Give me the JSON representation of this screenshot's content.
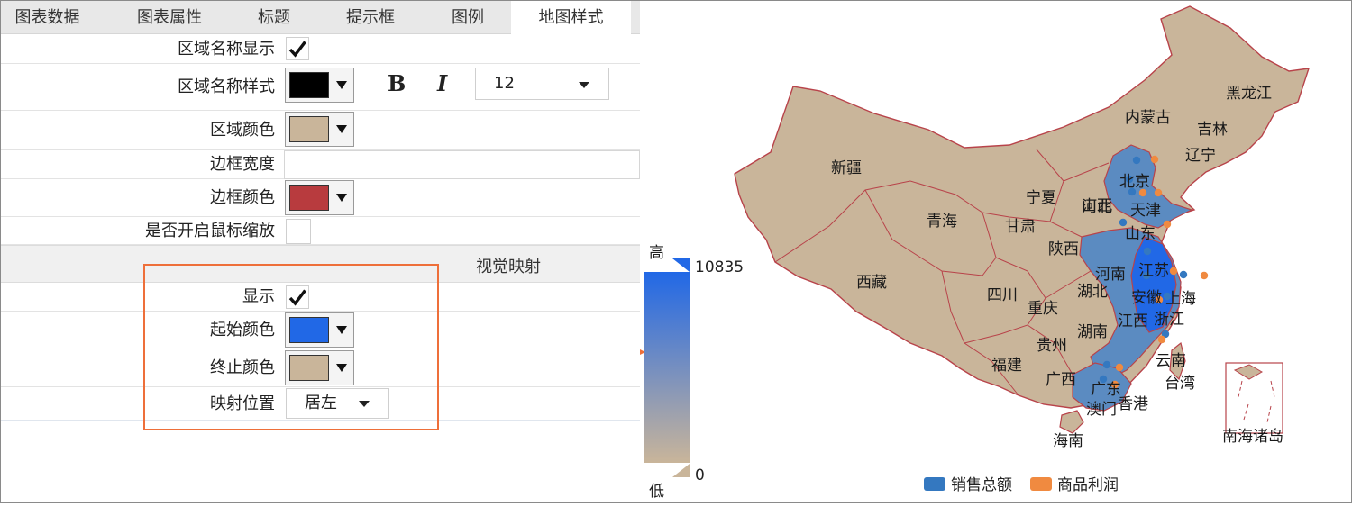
{
  "tabs": [
    {
      "label": "图表数据"
    },
    {
      "label": "图表属性"
    },
    {
      "label": "标题"
    },
    {
      "label": "提示框"
    },
    {
      "label": "图例"
    },
    {
      "label": "地图样式"
    }
  ],
  "settings": {
    "region_name_show": {
      "label": "区域名称显示",
      "checked": true
    },
    "region_name_style": {
      "label": "区域名称样式",
      "color": "#000000",
      "bold_label": "B",
      "italic_label": "I",
      "font_size": "12"
    },
    "region_color": {
      "label": "区域颜色",
      "color": "#c9b59a"
    },
    "border_width": {
      "label": "边框宽度",
      "value": ""
    },
    "border_color": {
      "label": "边框颜色",
      "color": "#b83b3e"
    },
    "mouse_zoom": {
      "label": "是否开启鼠标缩放",
      "checked": false
    }
  },
  "visual_map_section": {
    "title": "视觉映射",
    "show": {
      "label": "显示",
      "checked": true
    },
    "start_color": {
      "label": "起始颜色",
      "color": "#2168e6"
    },
    "end_color": {
      "label": "终止颜色",
      "color": "#c9b59a"
    },
    "position": {
      "label": "映射位置",
      "value": "居左"
    }
  },
  "map": {
    "visual_map": {
      "high_label": "高",
      "low_label": "低",
      "max": "10835",
      "min": "0"
    },
    "region_labels": [
      "黑龙江",
      "内蒙古",
      "吉林",
      "辽宁",
      "新疆",
      "北京",
      "宁夏",
      "天津",
      "河北",
      "山西",
      "青海",
      "甘肃",
      "山东",
      "陕西",
      "西藏",
      "江苏",
      "河南",
      "四川",
      "上海",
      "安徽",
      "湖北",
      "重庆",
      "浙江",
      "江西",
      "湖南",
      "贵州",
      "福建",
      "云南",
      "台湾",
      "广西",
      "广东",
      "香港",
      "澳门",
      "海南",
      "南海诸岛"
    ],
    "colors": {
      "land": "#c9b59a",
      "border": "#b8434a",
      "high": "#2168e6",
      "mid": "#5b8bc1",
      "sales_dot": "#3478c0",
      "profit_dot": "#f08a40"
    }
  },
  "legend": {
    "items": [
      {
        "name": "销售总额",
        "color": "#3478c0"
      },
      {
        "name": "商品利润",
        "color": "#f08a40"
      }
    ]
  }
}
